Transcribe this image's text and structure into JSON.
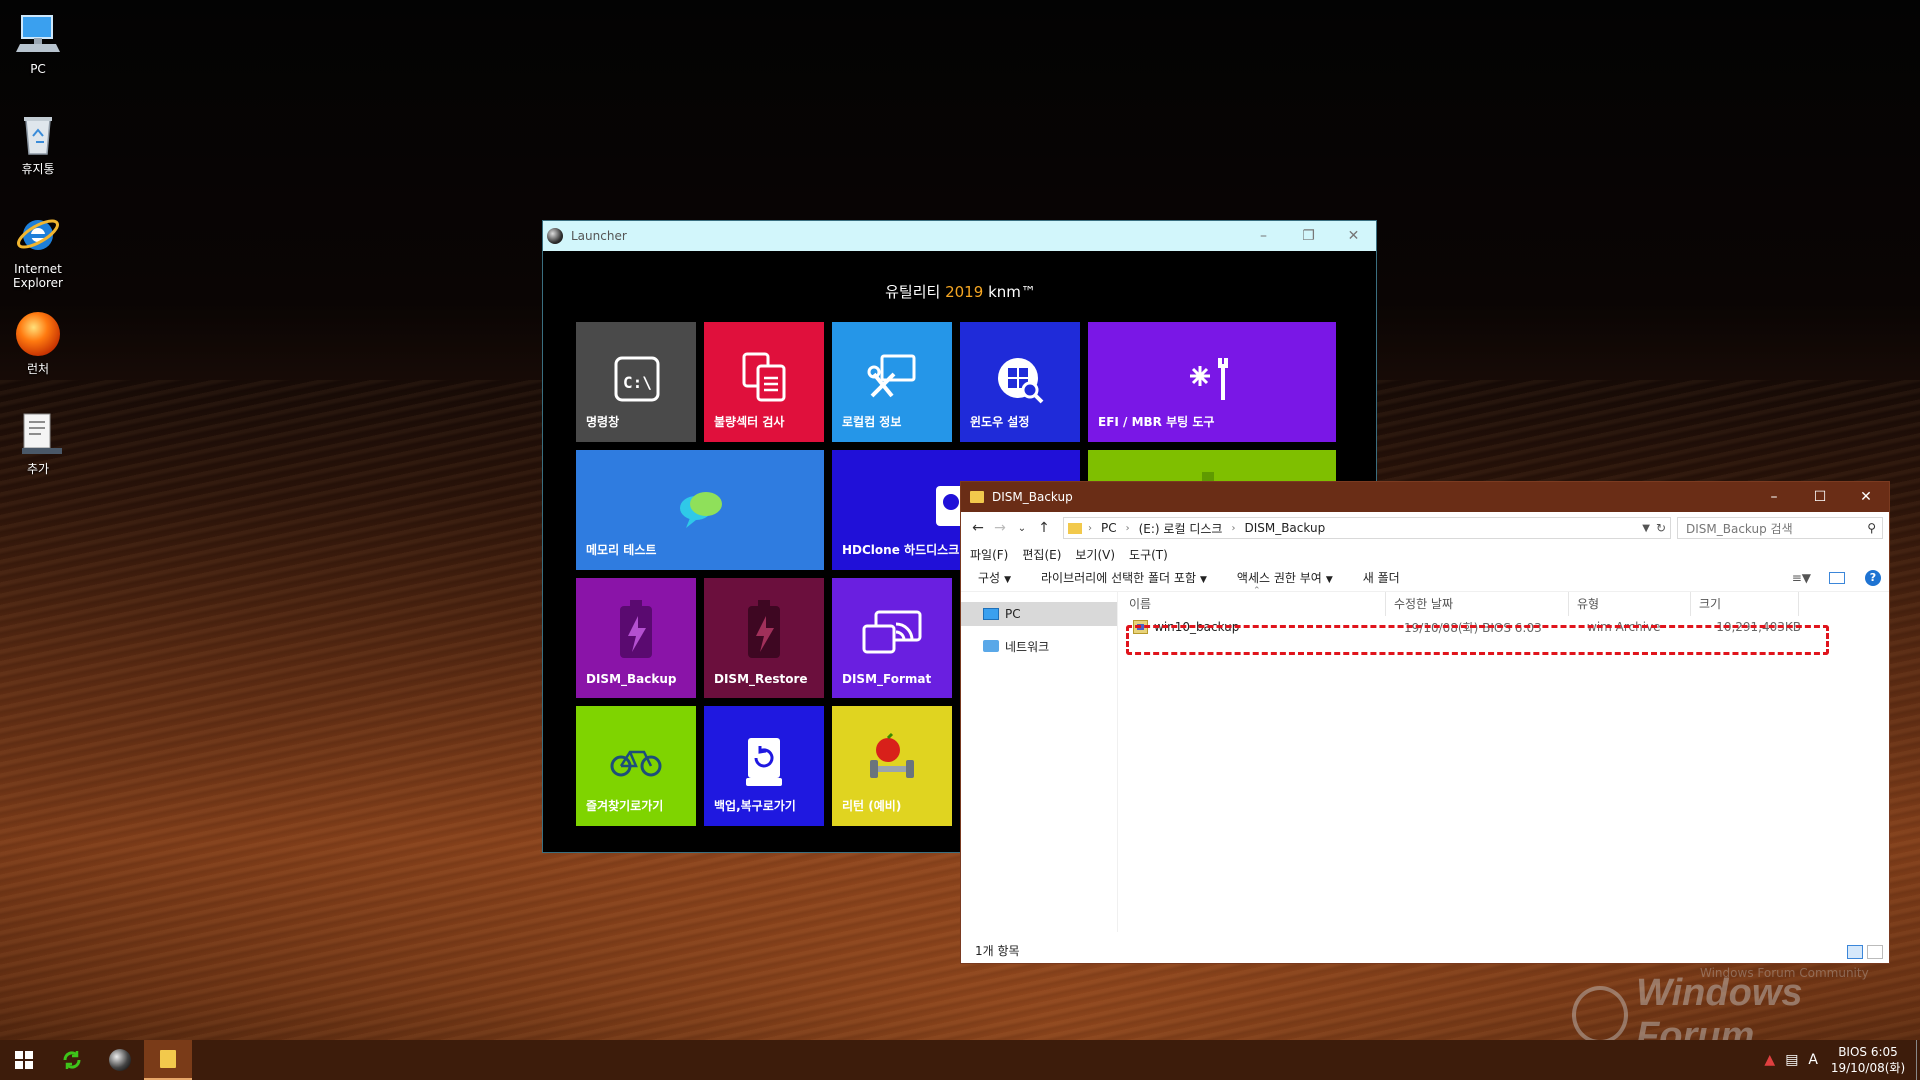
{
  "desktop": {
    "icons": [
      {
        "label": "PC",
        "icon": "pc-icon"
      },
      {
        "label": "휴지통",
        "icon": "recycle-bin-icon"
      },
      {
        "label": "Internet Explorer",
        "icon": "internet-explorer-icon"
      },
      {
        "label": "런처",
        "icon": "launcher-orb-icon"
      },
      {
        "label": "추가",
        "icon": "notepad-icon"
      }
    ]
  },
  "launcher": {
    "title": "Launcher",
    "header_prefix": "유틸리티",
    "header_year": "2019",
    "header_suffix": "knm™",
    "tiles": [
      {
        "label": "명령창",
        "color": "#4a4a4a",
        "icon": "command-prompt-icon"
      },
      {
        "label": "불량섹터 검사",
        "color": "#e0103c",
        "icon": "documents-icon"
      },
      {
        "label": "로컬컴 정보",
        "color": "#2596e8",
        "icon": "tools-icon"
      },
      {
        "label": "윈도우 설정",
        "color": "#1f2bd9",
        "icon": "windows-settings-icon"
      },
      {
        "label": "EFI / MBR 부팅 도구",
        "color": "#7a17e6",
        "icon": "wrench-icon"
      },
      {
        "label": "메모리 테스트",
        "color": "#2f7ce0",
        "icon": "chat-bubbles-icon"
      },
      {
        "label": "HDClone 하드디스크",
        "color": "#2010d8",
        "icon": "hdclone-icon"
      },
      {
        "label": "",
        "color": "#7fbf00",
        "icon": "partition-icon"
      },
      {
        "label": "DISM_Backup",
        "color": "#8a14a8",
        "icon": "battery-bolt-icon"
      },
      {
        "label": "DISM_Restore",
        "color": "#6b0f3d",
        "icon": "battery-bolt-icon"
      },
      {
        "label": "DISM_Format",
        "color": "#6a1fe0",
        "icon": "cast-screen-icon"
      },
      {
        "label": "즐겨찾기로가기",
        "color": "#7fd400",
        "icon": "bicycle-icon"
      },
      {
        "label": "백업,복구로가기",
        "color": "#1f18e0",
        "icon": "restore-drive-icon"
      },
      {
        "label": "리턴 (예비)",
        "color": "#e0d420",
        "icon": "apple-dumbbell-icon"
      }
    ]
  },
  "explorer": {
    "title": "DISM_Backup",
    "breadcrumb": [
      "PC",
      "(E:) 로컬 디스크",
      "DISM_Backup"
    ],
    "search_placeholder": "DISM_Backup 검색",
    "menu": [
      "파일(F)",
      "편집(E)",
      "보기(V)",
      "도구(T)"
    ],
    "toolbar": {
      "organize": "구성",
      "include_library": "라이브러리에 선택한 폴더 포함",
      "share": "액세스 권한 부여",
      "new_folder": "새 폴더"
    },
    "nav": [
      "PC",
      "네트워크"
    ],
    "columns": [
      "이름",
      "수정한 날짜",
      "유형",
      "크기"
    ],
    "rows": [
      {
        "name": "win10_backup",
        "modified": "19/10/08(화) BIOS  6:03",
        "type": "wim Archive",
        "size": "10,291,403KB"
      }
    ],
    "status": "1개 항목"
  },
  "watermark": {
    "brand": "Windows Forum",
    "sub": "Windows Forum Community"
  },
  "taskbar": {
    "clock_time": "BIOS  6:05",
    "clock_date": "19/10/08(화)",
    "ime": "A"
  }
}
